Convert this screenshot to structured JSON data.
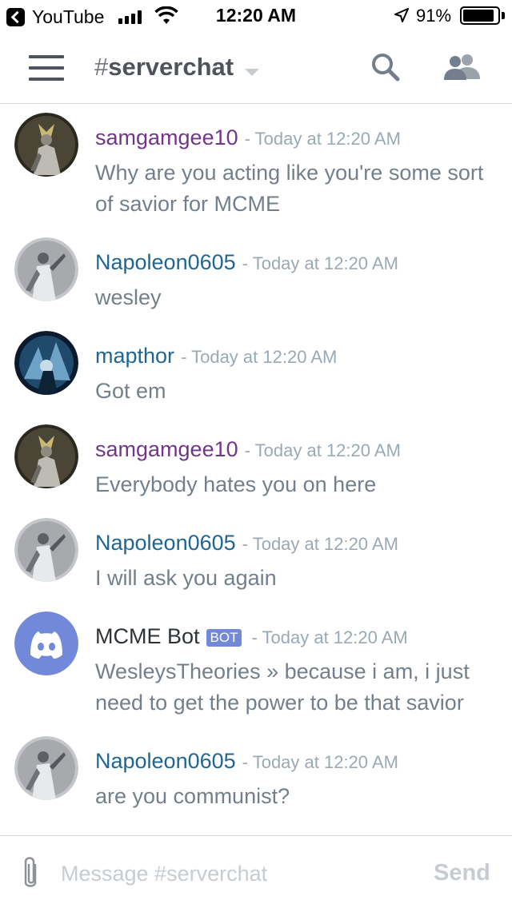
{
  "status_bar": {
    "back_app": "YouTube",
    "time": "12:20 AM",
    "battery": "91%",
    "battery_level": 0.91,
    "icons": [
      "back-chevron-icon",
      "signal-icon",
      "wifi-icon",
      "location-arrow-icon",
      "battery-icon"
    ]
  },
  "header": {
    "hash": "#",
    "channel": "serverchat",
    "icons": [
      "hamburger-menu-icon",
      "chevron-down-icon",
      "search-icon",
      "members-icon"
    ]
  },
  "colors": {
    "samgamgee10": "#71368a",
    "napoleon": "#206694",
    "mapthor": "#206694",
    "bot": "#2e3338",
    "bot_accent": "#7289da"
  },
  "messages": [
    {
      "author": "samgamgee10",
      "timestamp": "- Today at 12:20 AM",
      "text": "Why are you acting like you're some sort of savior for MCME"
    },
    {
      "author": "Napoleon0605",
      "timestamp": "- Today at 12:20 AM",
      "text": "wesley"
    },
    {
      "author": "mapthor",
      "timestamp": "- Today at 12:20 AM",
      "text": "Got em"
    },
    {
      "author": "samgamgee10",
      "timestamp": "- Today at 12:20 AM",
      "text": "Everybody hates you on here"
    },
    {
      "author": "Napoleon0605",
      "timestamp": "- Today at 12:20 AM",
      "text": "I will ask you again"
    },
    {
      "author": "MCME Bot",
      "tag": "BOT",
      "timestamp": "- Today at 12:20 AM",
      "text": "WesleysTheories » because i am, i just need to get the power to be that savior"
    },
    {
      "author": "Napoleon0605",
      "timestamp": "- Today at 12:20 AM",
      "text": "are you communist?"
    }
  ],
  "composer": {
    "placeholder": "Message #serverchat",
    "send_label": "Send",
    "icons": [
      "paperclip-icon"
    ]
  }
}
